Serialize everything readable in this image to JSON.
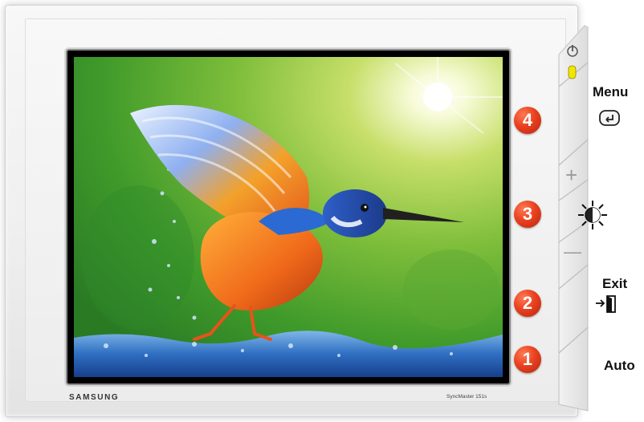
{
  "monitor": {
    "brand": "SAMSUNG",
    "model": "SyncMaster 151s"
  },
  "controls": {
    "menu": {
      "label": "Menu",
      "number": "4",
      "icon": "enter-icon"
    },
    "brightness": {
      "number": "3",
      "icon": "brightness-icon",
      "plus_symbol": "+",
      "minus_symbol": "—"
    },
    "exit": {
      "label": "Exit",
      "number": "2",
      "icon": "exit-door-icon"
    },
    "auto": {
      "label": "Auto",
      "number": "1"
    },
    "power": {
      "icon": "power-icon",
      "led": "led-indicator"
    }
  },
  "colors": {
    "badge": "#e9411f",
    "led": "#f2e600"
  }
}
